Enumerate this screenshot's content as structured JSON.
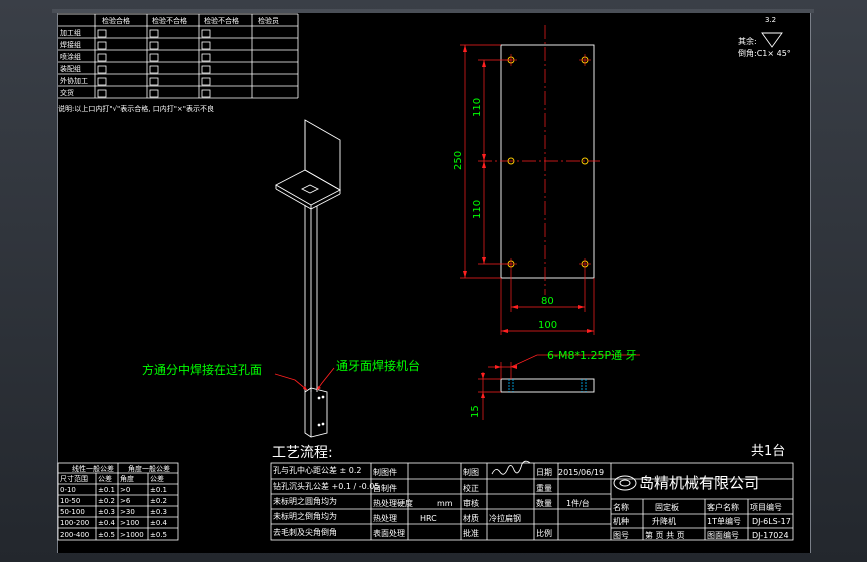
{
  "quality_table": {
    "headers": [
      "检验项目",
      "检验合格",
      "检验不合格",
      "检验员"
    ],
    "rows": [
      "加工组",
      "焊接组",
      "喷涂组",
      "装配组",
      "线切割",
      "外协加工",
      "交货"
    ],
    "note": "说明:以上口内打\"√\"表示合格, 口内打\"×\"表示不良"
  },
  "top_right": {
    "roughness_label": "其余:",
    "chamfer_note": "倒角:C1× 45°",
    "cropped_text": "3.2"
  },
  "dimensions": {
    "h1": "110",
    "h2": "110",
    "total_h": "250",
    "w1": "80",
    "w2": "100",
    "thread_note": "6-M8*1.25P通 牙",
    "thickness": "15"
  },
  "annotations": {
    "weld_center": "方通分中焊接在过孔面",
    "weld_tap": "通牙面焊接机台"
  },
  "process_title": "工艺流程:",
  "quantity_total": "共1台",
  "tolerance_table": {
    "title": "线性一般公差",
    "title2": "角度一般公差",
    "rows": [
      [
        "尺寸范围",
        "公差",
        "角度",
        "公差"
      ],
      [
        "0-10",
        "±0.1",
        ">0",
        "±0.1"
      ],
      [
        "10-50",
        "±0.2",
        ">6",
        "±0.2"
      ],
      [
        "50-100",
        "±0.3",
        ">30",
        "±0.3"
      ],
      [
        "100-200",
        "±0.4",
        ">100",
        "±0.4"
      ],
      [
        "200-400",
        "±0.5",
        ">1000",
        "±0.5"
      ]
    ]
  },
  "notes_table": [
    "孔与孔中心距公差 ± 0.2",
    "钻孔沉头孔公差 +0.1 / -0.05",
    "未标明之圆角均为",
    "未标明之倒角均为",
    "去毛刺及尖角倒角"
  ],
  "title_block": {
    "drawn_by": "制图件",
    "drawn_by2": "自制件",
    "heat_treat": "热处理",
    "hardness": "热处理硬度",
    "hardness_unit": "mm",
    "hrc": "HRC",
    "surface": "表面处理",
    "draw_label": "制图",
    "check_label": "校正",
    "material_label": "材质",
    "material": "冷拉扁钢",
    "approve_label": "审核",
    "sign_label": "批准",
    "date_label": "日期",
    "date": "2015/06/19",
    "weight_label": "重量",
    "qty_label": "数量",
    "qty": "1件/台",
    "ratio_label": "比例",
    "name_label": "名称",
    "part_name": "固定板",
    "company": "岛精机械有限公司",
    "machine_label": "机种",
    "machine": "升降机",
    "customer_label": "客户名称",
    "project_label": "项目编号",
    "project_no": "1T单编号",
    "drawing_label": "图号",
    "drawing_no": "DJ-6LS-17",
    "drawing_no2": "DJ-17024",
    "page_label": "图面编号",
    "sheet_label": "第 页 共 页"
  },
  "colors": {
    "dimension": "#00ff00",
    "annotation": "#ff2020",
    "lines": "#ffffff",
    "holes": "#ffcc00"
  }
}
